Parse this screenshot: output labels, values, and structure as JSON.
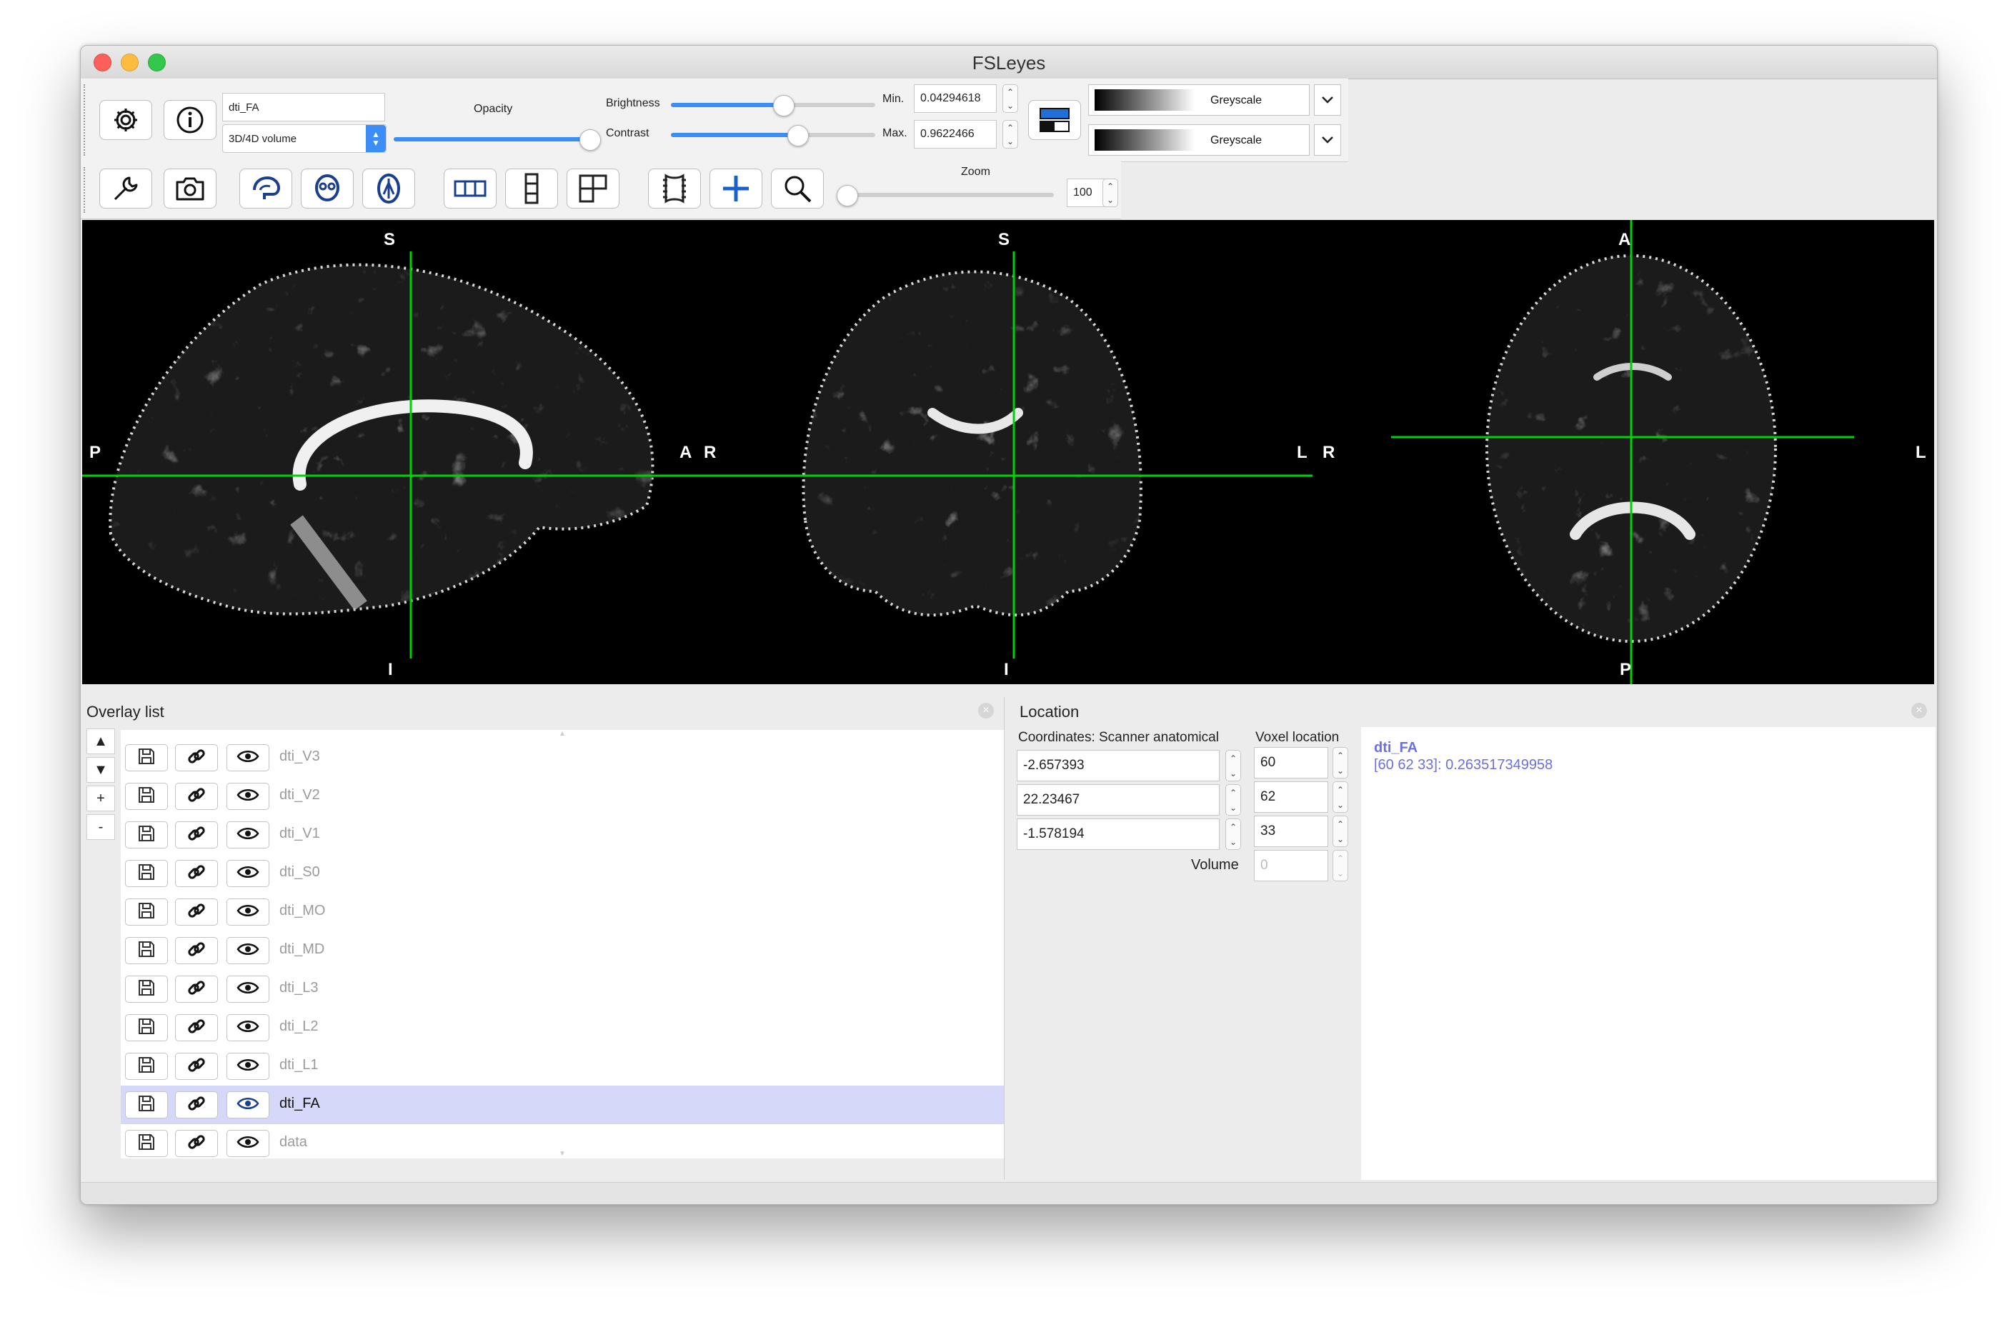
{
  "window": {
    "title": "FSLeyes"
  },
  "overlay_toolbar": {
    "overlay_name": "dti_FA",
    "overlay_type": "3D/4D volume",
    "opacity_label": "Opacity",
    "opacity_level": 0.98,
    "brightness_label": "Brightness",
    "brightness_level": 0.55,
    "contrast_label": "Contrast",
    "contrast_level": 0.62,
    "min_label": "Min.",
    "min_value": "0.04294618",
    "max_label": "Max.",
    "max_value": "0.9622466",
    "cmap_primary": "Greyscale",
    "cmap_secondary": "Greyscale"
  },
  "view_toolbar": {
    "zoom_label": "Zoom",
    "zoom_value": "100",
    "zoom_level": 0.0
  },
  "viewer": {
    "sagittal": {
      "top": "S",
      "bottom": "I",
      "left": "P",
      "right": "A"
    },
    "coronal": {
      "top": "S",
      "bottom": "I",
      "left": "R",
      "right": "L"
    },
    "axial": {
      "top": "A",
      "bottom": "P",
      "left": "R",
      "right": "L"
    },
    "crosshair_color": "#00d100"
  },
  "overlay_list": {
    "title": "Overlay list",
    "controls": {
      "up": "▲",
      "down": "▼",
      "add": "+",
      "remove": "-"
    },
    "items": [
      {
        "name": "dti_V3",
        "selected": false
      },
      {
        "name": "dti_V2",
        "selected": false
      },
      {
        "name": "dti_V1",
        "selected": false
      },
      {
        "name": "dti_S0",
        "selected": false
      },
      {
        "name": "dti_MO",
        "selected": false
      },
      {
        "name": "dti_MD",
        "selected": false
      },
      {
        "name": "dti_L3",
        "selected": false
      },
      {
        "name": "dti_L2",
        "selected": false
      },
      {
        "name": "dti_L1",
        "selected": false
      },
      {
        "name": "dti_FA",
        "selected": true
      },
      {
        "name": "data",
        "selected": false
      }
    ]
  },
  "location": {
    "title": "Location",
    "coords_label": "Coordinates: Scanner anatomical",
    "voxel_label": "Voxel location",
    "coords": [
      "-2.657393",
      "22.23467",
      "-1.578194"
    ],
    "voxels": [
      "60",
      "62",
      "33"
    ],
    "volume_label": "Volume",
    "volume_value": "0",
    "info_name": "dti_FA",
    "info_value": "[60 62 33]: 0.263517349958",
    "info_color": "#6b6fe0"
  }
}
